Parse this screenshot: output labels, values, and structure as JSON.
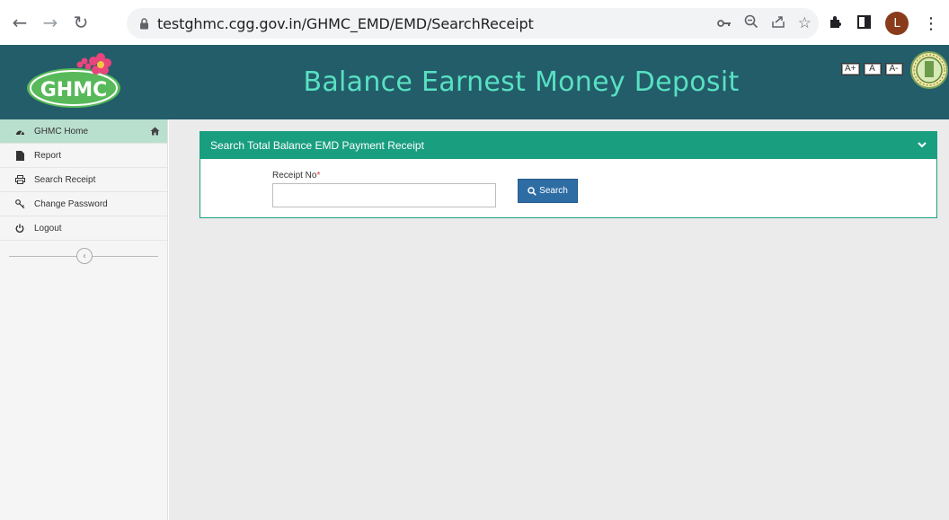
{
  "browser": {
    "url": "testghmc.cgg.gov.in/GHMC_EMD/EMD/SearchReceipt",
    "profile_initial": "L"
  },
  "header": {
    "logo_text": "GHMC",
    "title": "Balance Earnest Money Deposit",
    "font_buttons": [
      "A+",
      "A",
      "A-"
    ]
  },
  "sidebar": {
    "items": [
      {
        "label": "GHMC Home",
        "icon": "dashboard-icon"
      },
      {
        "label": "Report",
        "icon": "file-icon"
      },
      {
        "label": "Search Receipt",
        "icon": "printer-icon"
      },
      {
        "label": "Change Password",
        "icon": "key-icon"
      },
      {
        "label": "Logout",
        "icon": "power-icon"
      }
    ]
  },
  "panel": {
    "title": "Search Total Balance EMD Payment Receipt",
    "field_label": "Receipt No",
    "required_mark": "*",
    "input_value": "",
    "search_label": "Search"
  },
  "colors": {
    "header_bg": "#235d6a",
    "title_color": "#58e1c2",
    "panel_accent": "#199e80",
    "active_item": "#b9dfcf",
    "button": "#2e6da4"
  }
}
